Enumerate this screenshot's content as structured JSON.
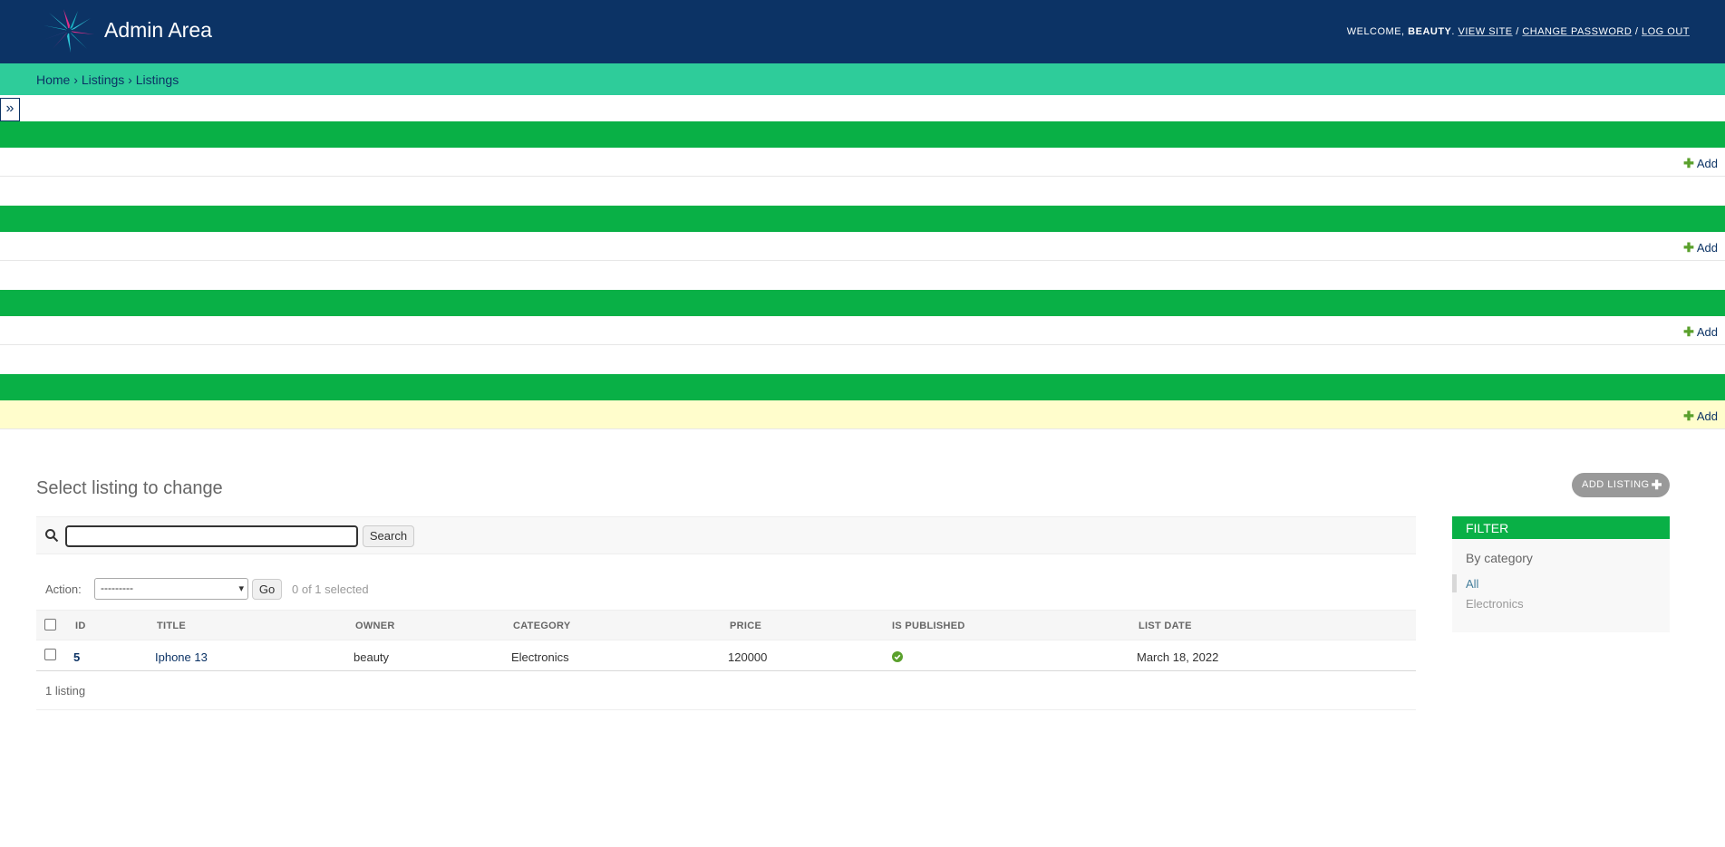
{
  "header": {
    "site_title": "Admin Area",
    "welcome_text": "Welcome, ",
    "username": "beauty",
    "links": [
      "View site",
      "Change password",
      "Log out"
    ],
    "separator": " / "
  },
  "breadcrumbs": {
    "items": [
      "Home",
      "Listings",
      "Listings"
    ],
    "separator": " › "
  },
  "sidebar": {
    "toggle_label": "»",
    "add_label": "Add",
    "modules_count": 4
  },
  "content": {
    "page_title": "Select listing to change",
    "add_button_label": "ADD LISTING",
    "search": {
      "value": "",
      "button_label": "Search"
    },
    "actions": {
      "label": "Action:",
      "selected_option": "---------",
      "go_label": "Go",
      "selected_counter": "0 of 1 selected"
    },
    "table": {
      "columns": [
        "ID",
        "TITLE",
        "OWNER",
        "CATEGORY",
        "PRICE",
        "IS PUBLISHED",
        "LIST DATE"
      ],
      "rows": [
        {
          "id": "5",
          "title": "Iphone 13",
          "owner": "beauty",
          "category": "Electronics",
          "price": "120000",
          "is_published": true,
          "list_date": "March 18, 2022"
        }
      ]
    },
    "paginator": "1 listing"
  },
  "filter": {
    "header": "FILTER",
    "title": "By category",
    "options": [
      "All",
      "Electronics"
    ],
    "selected": "All"
  },
  "colors": {
    "header_bg": "#0c3365",
    "breadcrumb_bg": "#2ecc9a",
    "module_band": "#09b046",
    "highlight_row": "#fffdcc",
    "published_icon": "#5aa02c"
  }
}
